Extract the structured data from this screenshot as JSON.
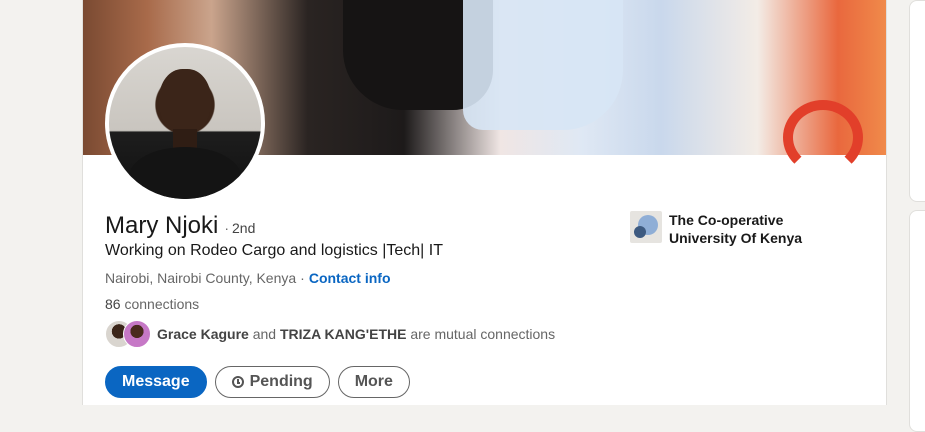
{
  "profile": {
    "name": "Mary Njoki",
    "degree": "2nd",
    "headline": "Working on Rodeo Cargo and logistics |Tech| IT",
    "location": "Nairobi, Nairobi County, Kenya",
    "contact_label": "Contact info",
    "connections_count": "86",
    "connections_label": "connections",
    "mutual": {
      "person1": "Grace Kagure",
      "and": "and",
      "person2": "TRIZA KANG'ETHE",
      "suffix": "are mutual connections"
    },
    "education": "The Co-operative University Of Kenya"
  },
  "actions": {
    "message": "Message",
    "pending": "Pending",
    "more": "More"
  },
  "colors": {
    "primary": "#0a66c2",
    "page_bg": "#f3f2ef"
  }
}
